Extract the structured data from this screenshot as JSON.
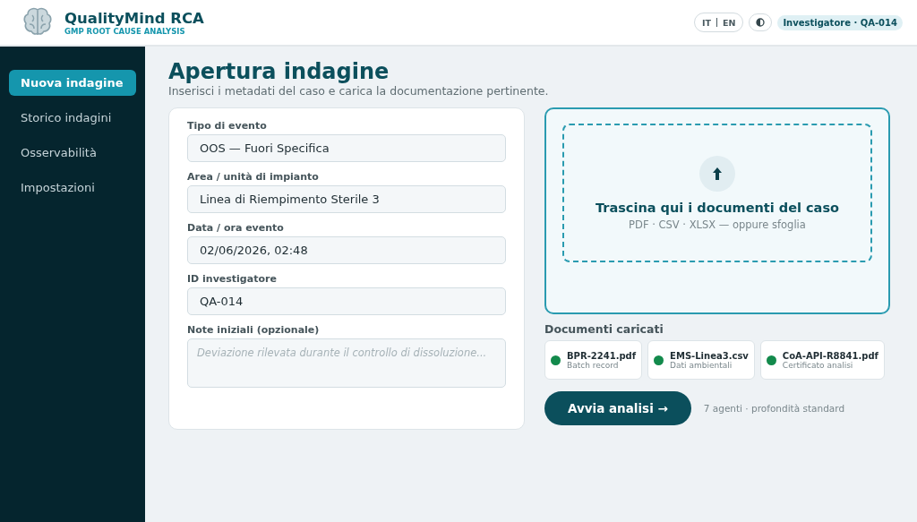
{
  "app": {
    "name": "QualityMind RCA",
    "tagline": "GMP ROOT CAUSE ANALYSIS"
  },
  "header": {
    "languages": [
      "IT",
      "EN"
    ],
    "user_badge": "Investigatore · QA-014"
  },
  "sidebar": {
    "items": [
      {
        "label": "Nuova indagine",
        "selected": true
      },
      {
        "label": "Storico indagini",
        "selected": false
      },
      {
        "label": "Osservabilità",
        "selected": false
      },
      {
        "label": "Impostazioni",
        "selected": false
      }
    ]
  },
  "page": {
    "title": "Apertura indagine",
    "subtitle": "Inserisci i metadati del caso e carica la documentazione pertinente."
  },
  "form": {
    "fields": [
      {
        "kind": "input",
        "label": "Tipo di evento",
        "value": "OOS — Fuori Specifica"
      },
      {
        "kind": "input",
        "label": "Area / unità di impianto",
        "value": "Linea di Riempimento Sterile 3"
      },
      {
        "kind": "input",
        "label": "Data / ora evento",
        "value": "02/06/2026, 02:48"
      },
      {
        "kind": "input",
        "label": "ID investigatore",
        "value": "QA-014"
      },
      {
        "kind": "textarea",
        "label": "Note iniziali (opzionale)",
        "placeholder": "Deviazione rilevata durante il controllo di dissoluzione..."
      }
    ]
  },
  "dropzone": {
    "title": "Trascina qui i documenti del caso",
    "hint": "PDF · CSV · XLSX — oppure sfoglia"
  },
  "documents": {
    "heading": "Documenti caricati",
    "items": [
      {
        "name": "BPR-2241.pdf",
        "description": "Batch record",
        "color": "#138a4c"
      },
      {
        "name": "EMS-Linea3.csv",
        "description": "Dati ambientali",
        "color": "#138a4c"
      },
      {
        "name": "CoA-API-R8841.pdf",
        "description": "Certificato analisi",
        "color": "#138a4c"
      }
    ]
  },
  "actions": {
    "button": "Avvia analisi →",
    "note": "7 agenti · profondità standard"
  }
}
